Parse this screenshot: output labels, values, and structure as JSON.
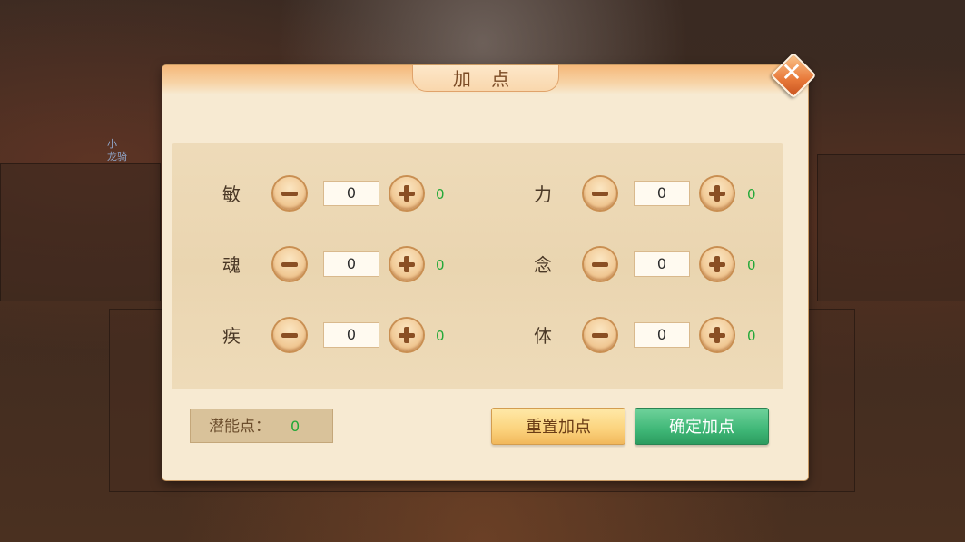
{
  "dialog": {
    "title": "加 点",
    "close_icon": "close-icon"
  },
  "background": {
    "name_line1": "小",
    "name_line2": "龙骑"
  },
  "stats": {
    "left": [
      {
        "label": "敏",
        "value": "0",
        "gain": "0"
      },
      {
        "label": "魂",
        "value": "0",
        "gain": "0"
      },
      {
        "label": "疾",
        "value": "0",
        "gain": "0"
      }
    ],
    "right": [
      {
        "label": "力",
        "value": "0",
        "gain": "0"
      },
      {
        "label": "念",
        "value": "0",
        "gain": "0"
      },
      {
        "label": "体",
        "value": "0",
        "gain": "0"
      }
    ]
  },
  "potential": {
    "label": "潜能点：",
    "value": "0"
  },
  "buttons": {
    "reset_label": "重置加点",
    "confirm_label": "确定加点"
  },
  "colors": {
    "gain_green": "#23a838",
    "confirm_green": "#3fb777",
    "reset_gold": "#fbd27c"
  }
}
